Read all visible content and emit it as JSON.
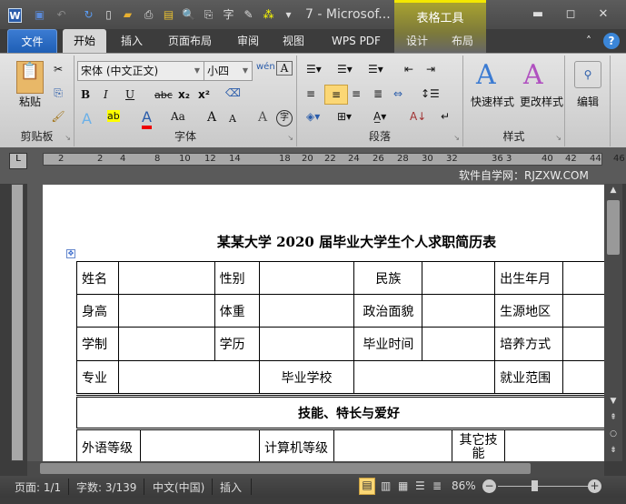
{
  "titlebar": {
    "app_icon": "W",
    "title": "7 - Microsof...",
    "context_tab_group": "表格工具",
    "quick_access": [
      "save-icon",
      "undo-icon",
      "redo-icon",
      "new-doc-icon",
      "open-icon",
      "print-icon",
      "folder-icon",
      "print-preview-icon",
      "attach-icon",
      "translate-icon",
      "form-icon",
      "diagram-icon",
      "customize-icon"
    ],
    "min": "▬",
    "max": "◻",
    "close": "✕"
  },
  "tabs": [
    "文件",
    "开始",
    "插入",
    "页面布局",
    "审阅",
    "视图",
    "WPS PDF",
    "设计",
    "布局"
  ],
  "ribbon": {
    "clipboard": {
      "label": "剪贴板",
      "paste": "粘贴"
    },
    "font": {
      "label": "字体",
      "font_name": "宋体 (中文正文)",
      "font_size": "小四",
      "buttons": [
        "B",
        "I",
        "U",
        "abc",
        "x₂",
        "x²",
        "A",
        "ab",
        "A",
        "Aa",
        "A",
        "A",
        "A",
        "字"
      ]
    },
    "paragraph": {
      "label": "段落"
    },
    "styles": {
      "label": "样式",
      "quick": "快速样式",
      "change": "更改样式"
    },
    "editing": {
      "label": "编辑"
    }
  },
  "ruler": {
    "ticks": [
      "2",
      "2",
      "4",
      "8",
      "10",
      "12",
      "14",
      "18",
      "20",
      "22",
      "24",
      "26",
      "28",
      "30",
      "32",
      "36",
      "3",
      "40",
      "42",
      "44",
      "46"
    ]
  },
  "watermark": "软件自学网：RJZXW.COM",
  "document": {
    "title": "某某大学 2020 届毕业大学生个人求职简历表",
    "rows": [
      [
        "姓名",
        "",
        "性别",
        "",
        "民族",
        "",
        "出生年月",
        ""
      ],
      [
        "身高",
        "",
        "体重",
        "",
        "政治面貌",
        "",
        "生源地区",
        ""
      ],
      [
        "学制",
        "",
        "学历",
        "",
        "毕业时间",
        "",
        "培养方式",
        ""
      ],
      [
        "专业",
        "",
        "毕业学校",
        "",
        "就业范围",
        ""
      ]
    ],
    "section": "技能、特长与爱好",
    "skills_row": [
      "外语等级",
      "",
      "计算机等级",
      "",
      "其它技能",
      ""
    ]
  },
  "status": {
    "page": "页面: 1/1",
    "words": "字数: 3/139",
    "language": "中文(中国)",
    "mode": "插入",
    "zoom": "86%"
  }
}
